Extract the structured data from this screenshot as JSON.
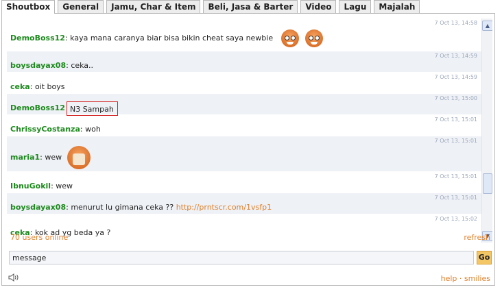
{
  "tabs": [
    "Shoutbox",
    "General",
    "Jamu, Char & Item",
    "Beli, Jasa & Barter",
    "Video",
    "Lagu",
    "Majalah"
  ],
  "messages": [
    {
      "time": "7 Oct 13, 14:58",
      "user": "DemoBoss12",
      "sep": ": ",
      "text": "kaya mana caranya biar bisa bikin cheat saya newbie",
      "smileys": [
        "laughing-smiley-icon",
        "laughing-smiley-icon"
      ]
    },
    {
      "time": "7 Oct 13, 14:59",
      "user": "boysdayax08",
      "sep": ": ",
      "text": "ceka.."
    },
    {
      "time": "7 Oct 13, 14:59",
      "user": "ceka",
      "sep": ": ",
      "text": "oit boys"
    },
    {
      "time": "7 Oct 13, 15:00",
      "user": "DemoBoss12",
      "sep": "",
      "text": "N3 Sampah"
    },
    {
      "time": "7 Oct 13, 15:01",
      "user": "ChrissyCostanza",
      "sep": ": ",
      "text": "woh"
    },
    {
      "time": "7 Oct 13, 15:01",
      "user": "maria1",
      "sep": ": ",
      "text": "wew",
      "smileys": [
        "mask-smiley-icon"
      ]
    },
    {
      "time": "7 Oct 13, 15:01",
      "user": "IbnuGokil",
      "sep": ": ",
      "text": "wew"
    },
    {
      "time": "7 Oct 13, 15:01",
      "user": "boysdayax08",
      "sep": ": ",
      "text": "menurut lu gimana ceka ?? ",
      "link": "http://prntscr.com/1vsfp1"
    },
    {
      "time": "7 Oct 13, 15:02",
      "user": "ceka",
      "sep": ": ",
      "text": "kok ad yg beda ya ?"
    }
  ],
  "footer": {
    "online": "70 users online",
    "refresh": "refresh",
    "input_value": "message",
    "go": "Go",
    "help": "help",
    "dot": " · ",
    "smilies": "smilies"
  },
  "colors": {
    "accent": "#e0802a",
    "username": "#1e8a1e",
    "highlight_border": "#d42020"
  }
}
